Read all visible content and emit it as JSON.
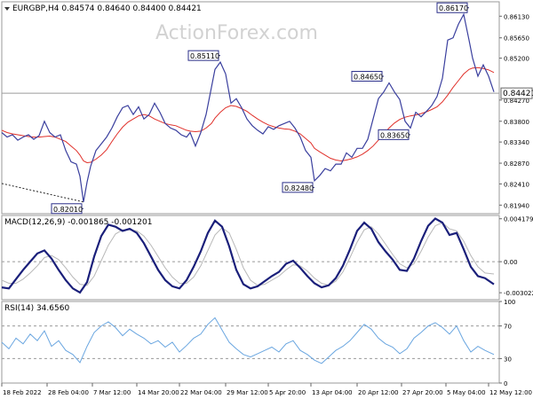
{
  "watermark": "ActionForex.com",
  "colors": {
    "price": "#3a3f9e",
    "sma": "#e0302a",
    "macd": "#1a1f7a",
    "signal": "#b8b8b8",
    "rsi": "#6aa6e0",
    "label_border": "#2b2f8a",
    "grid": "#c9c9c9",
    "price_line": "#9a9a9a"
  },
  "chart_data": [
    {
      "type": "line",
      "panel": "price",
      "header": "EURGBP,H4  0.84574 0.84640 0.84400 0.84421",
      "current_price": "0.84421",
      "ylim": [
        0.8175,
        0.8645
      ],
      "yticks": [
        "0.86130",
        "0.85650",
        "0.85200",
        "0.84270",
        "0.83800",
        "0.83340",
        "0.82870",
        "0.82410",
        "0.81940"
      ],
      "ytick_values": [
        0.8613,
        0.8565,
        0.852,
        0.8427,
        0.838,
        0.8334,
        0.8287,
        0.8241,
        0.8194
      ],
      "x": [
        0,
        6,
        12,
        18,
        24,
        30,
        36,
        42,
        48,
        54,
        60,
        66,
        72,
        78,
        84,
        88,
        92,
        96,
        100,
        106,
        112,
        118,
        124,
        130,
        136,
        142,
        148,
        154,
        160,
        166,
        172,
        178,
        184,
        190,
        196,
        202,
        208,
        212,
        218,
        224,
        230,
        236,
        240,
        246,
        252,
        258,
        264,
        270,
        276,
        282,
        288,
        294,
        300,
        306,
        312,
        318,
        324,
        330,
        336,
        342,
        348,
        352,
        358,
        364,
        370,
        376,
        382,
        388,
        394,
        400,
        406,
        412,
        418,
        424,
        430,
        436,
        442,
        448,
        454,
        460,
        466,
        472,
        478,
        484,
        490,
        496,
        502,
        508,
        514,
        520,
        526,
        530,
        536,
        542,
        548,
        554
      ],
      "series": [
        {
          "values": [
            0.8355,
            0.8345,
            0.835,
            0.8338,
            0.8345,
            0.835,
            0.834,
            0.8348,
            0.838,
            0.8355,
            0.8345,
            0.835,
            0.8315,
            0.829,
            0.8285,
            0.8258,
            0.8201,
            0.8245,
            0.828,
            0.8315,
            0.833,
            0.8345,
            0.8365,
            0.839,
            0.841,
            0.8415,
            0.8395,
            0.8412,
            0.8385,
            0.8395,
            0.842,
            0.84,
            0.8375,
            0.8365,
            0.836,
            0.835,
            0.8345,
            0.8355,
            0.8325,
            0.8355,
            0.8395,
            0.8455,
            0.8495,
            0.8511,
            0.8485,
            0.842,
            0.843,
            0.841,
            0.8385,
            0.837,
            0.836,
            0.8352,
            0.8368,
            0.8362,
            0.837,
            0.8375,
            0.838,
            0.8365,
            0.8345,
            0.8315,
            0.83,
            0.8248,
            0.826,
            0.8275,
            0.827,
            0.8285,
            0.8285,
            0.831,
            0.83,
            0.832,
            0.832,
            0.834,
            0.8385,
            0.843,
            0.8445,
            0.8465,
            0.8445,
            0.8428,
            0.838,
            0.8365,
            0.84,
            0.839,
            0.8402,
            0.8415,
            0.8435,
            0.8475,
            0.856,
            0.8565,
            0.8595,
            0.8617,
            0.856,
            0.852,
            0.848,
            0.8505,
            0.848,
            0.8445
          ]
        },
        {
          "values": [
            0.836,
            0.8355,
            0.8352,
            0.835,
            0.8348,
            0.8346,
            0.8345,
            0.8345,
            0.8346,
            0.8347,
            0.8345,
            0.834,
            0.8335,
            0.8325,
            0.8315,
            0.8305,
            0.8292,
            0.8288,
            0.8289,
            0.8296,
            0.8305,
            0.8317,
            0.8335,
            0.8352,
            0.8367,
            0.8378,
            0.8385,
            0.8392,
            0.8395,
            0.8392,
            0.8385,
            0.838,
            0.8375,
            0.8372,
            0.837,
            0.8365,
            0.836,
            0.8358,
            0.8357,
            0.8358,
            0.8365,
            0.8375,
            0.8387,
            0.84,
            0.841,
            0.8415,
            0.8413,
            0.8408,
            0.8402,
            0.8393,
            0.8385,
            0.8378,
            0.8372,
            0.8368,
            0.8365,
            0.8363,
            0.8362,
            0.8358,
            0.8352,
            0.8342,
            0.8332,
            0.832,
            0.8312,
            0.8305,
            0.8298,
            0.8294,
            0.8292,
            0.8294,
            0.8297,
            0.8301,
            0.8307,
            0.8315,
            0.8325,
            0.8338,
            0.8352,
            0.8365,
            0.8376,
            0.8384,
            0.8389,
            0.8392,
            0.8394,
            0.8397,
            0.8401,
            0.8406,
            0.8412,
            0.8423,
            0.8438,
            0.8455,
            0.847,
            0.8485,
            0.8495,
            0.8498,
            0.8499,
            0.8497,
            0.8494,
            0.8488
          ]
        }
      ],
      "annotations": [
        {
          "label": "0.82010",
          "x": 92,
          "value": 0.8201,
          "side": "below"
        },
        {
          "label": "0.85110",
          "x": 246,
          "value": 0.8511,
          "side": "above"
        },
        {
          "label": "0.82480",
          "x": 352,
          "value": 0.8248,
          "side": "below"
        },
        {
          "label": "0.84650",
          "x": 430,
          "value": 0.8465,
          "side": "above"
        },
        {
          "label": "0.83650",
          "x": 460,
          "value": 0.8365,
          "side": "below"
        },
        {
          "label": "0.86170",
          "x": 526,
          "value": 0.8617,
          "side": "above"
        }
      ],
      "trendline": [
        [
          0,
          0.8242
        ],
        [
          92,
          0.8201
        ]
      ]
    },
    {
      "type": "line",
      "panel": "macd",
      "header": "MACD(12,26,9) -0.001865 -0.001201",
      "ylim": [
        -0.0037,
        0.0045
      ],
      "yticks": [
        "0.004179",
        "0.00",
        "-0.003022"
      ],
      "ytick_values": [
        0.004179,
        0,
        -0.003022
      ],
      "zero_line": 0,
      "x": [
        0,
        8,
        16,
        24,
        32,
        40,
        48,
        56,
        64,
        72,
        80,
        88,
        96,
        104,
        112,
        120,
        128,
        136,
        144,
        152,
        160,
        168,
        176,
        184,
        192,
        200,
        208,
        216,
        224,
        232,
        240,
        248,
        256,
        264,
        272,
        280,
        288,
        296,
        304,
        312,
        320,
        328,
        336,
        344,
        352,
        360,
        368,
        376,
        384,
        392,
        400,
        408,
        416,
        424,
        432,
        440,
        448,
        456,
        464,
        472,
        480,
        488,
        496,
        504,
        512,
        520,
        528,
        536,
        544,
        554
      ],
      "series": [
        {
          "values": [
            -0.0025,
            -0.0026,
            -0.0017,
            -0.0008,
            0.0,
            0.0008,
            0.0011,
            0.0003,
            -0.0008,
            -0.0018,
            -0.0026,
            -0.003,
            -0.002,
            0.0005,
            0.0025,
            0.0036,
            0.0034,
            0.003,
            0.0032,
            0.0028,
            0.0018,
            0.0005,
            -0.0008,
            -0.0018,
            -0.0024,
            -0.0026,
            -0.0018,
            -0.0005,
            0.001,
            0.0028,
            0.004,
            0.0034,
            0.0015,
            -0.0008,
            -0.0022,
            -0.0026,
            -0.0024,
            -0.0019,
            -0.0014,
            -0.001,
            -0.0002,
            0.0001,
            -0.0006,
            -0.0014,
            -0.0021,
            -0.0025,
            -0.0023,
            -0.0016,
            -0.0004,
            0.0012,
            0.003,
            0.0038,
            0.0032,
            0.0019,
            0.001,
            0.0002,
            -0.0008,
            -0.0009,
            0.0003,
            0.002,
            0.0035,
            0.0042,
            0.0038,
            0.0026,
            0.0028,
            0.0012,
            -0.0005,
            -0.0014,
            -0.0016,
            -0.0022
          ]
        },
        {
          "values": [
            -0.0018,
            -0.0021,
            -0.0021,
            -0.0017,
            -0.0011,
            -0.0004,
            0.0004,
            0.0006,
            0.0002,
            -0.0006,
            -0.0015,
            -0.0022,
            -0.0023,
            -0.0014,
            0.0001,
            0.0016,
            0.0027,
            0.0031,
            0.0031,
            0.003,
            0.0025,
            0.0016,
            0.0005,
            -0.0006,
            -0.0015,
            -0.0021,
            -0.0021,
            -0.0015,
            -0.0004,
            0.0011,
            0.0026,
            0.0033,
            0.0028,
            0.0012,
            -0.0006,
            -0.0018,
            -0.0023,
            -0.0022,
            -0.0018,
            -0.0014,
            -0.0008,
            -0.0003,
            -0.0004,
            -0.0009,
            -0.0016,
            -0.0021,
            -0.0023,
            -0.0019,
            -0.001,
            0.0004,
            0.0019,
            0.0031,
            0.0034,
            0.0027,
            0.0017,
            0.0007,
            -0.0002,
            -0.0006,
            -0.0002,
            0.001,
            0.0024,
            0.0035,
            0.0038,
            0.0032,
            0.003,
            0.002,
            0.0006,
            -0.0005,
            -0.0011,
            -0.0012
          ]
        }
      ]
    },
    {
      "type": "line",
      "panel": "rsi",
      "header": "RSI(14) 34.6560",
      "ylim": [
        0,
        100
      ],
      "yticks": [
        "100",
        "70",
        "30",
        "0"
      ],
      "ytick_values": [
        100,
        70,
        30,
        0
      ],
      "levels": [
        70,
        30
      ],
      "x": [
        0,
        8,
        16,
        24,
        32,
        40,
        48,
        56,
        64,
        72,
        80,
        88,
        96,
        104,
        112,
        120,
        128,
        136,
        144,
        152,
        160,
        168,
        176,
        184,
        192,
        200,
        208,
        216,
        224,
        232,
        240,
        248,
        256,
        264,
        272,
        280,
        288,
        296,
        304,
        312,
        320,
        328,
        336,
        344,
        352,
        360,
        368,
        376,
        384,
        392,
        400,
        408,
        416,
        424,
        432,
        440,
        448,
        456,
        464,
        472,
        480,
        488,
        496,
        504,
        512,
        520,
        528,
        536,
        544,
        554
      ],
      "series": [
        {
          "values": [
            50,
            42,
            55,
            48,
            60,
            52,
            64,
            45,
            52,
            40,
            35,
            25,
            45,
            62,
            70,
            75,
            68,
            58,
            66,
            60,
            55,
            48,
            52,
            44,
            50,
            38,
            46,
            55,
            60,
            72,
            80,
            65,
            50,
            42,
            35,
            32,
            36,
            40,
            44,
            38,
            48,
            52,
            40,
            35,
            28,
            24,
            32,
            40,
            45,
            52,
            62,
            72,
            66,
            55,
            48,
            44,
            36,
            42,
            55,
            62,
            70,
            74,
            68,
            60,
            70,
            52,
            38,
            45,
            40,
            35
          ]
        }
      ]
    }
  ],
  "x_axis": {
    "labels": [
      "18 Feb 2022",
      "28 Feb 04:00",
      "7 Mar 12:00",
      "14 Mar 20:00",
      "22 Mar 04:00",
      "29 Mar 12:00",
      "5 Apr 20:00",
      "13 Apr 04:00",
      "20 Apr 12:00",
      "27 Apr 20:00",
      "5 May 04:00",
      "12 May 12:00"
    ],
    "positions": [
      0,
      51,
      102,
      152,
      200,
      252,
      300,
      348,
      400,
      450,
      500,
      548
    ]
  }
}
